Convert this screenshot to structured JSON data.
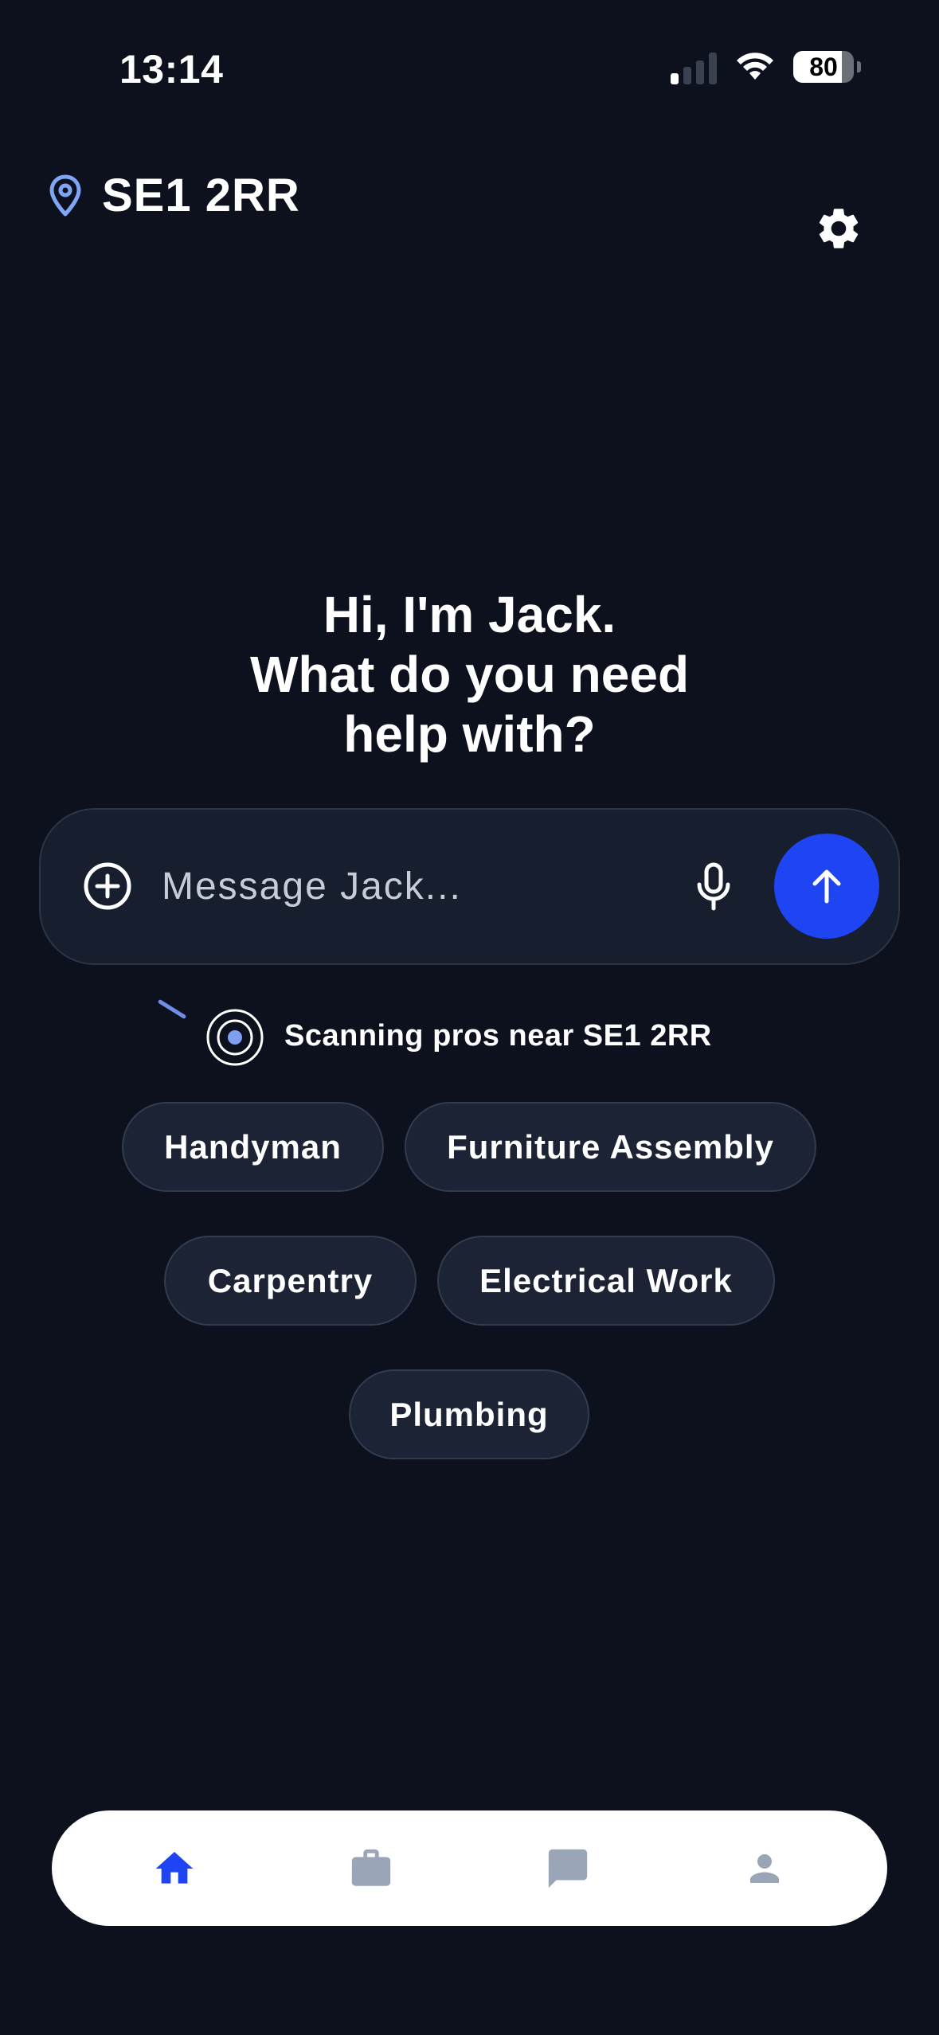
{
  "status_bar": {
    "time": "13:14",
    "battery_percent": "80",
    "signal_bars_active": 1,
    "signal_bars_total": 4
  },
  "header": {
    "location_icon": "map-pin-icon",
    "location": "SE1 2RR",
    "settings_icon": "gear-icon"
  },
  "greeting": {
    "line1": "Hi, I'm Jack.",
    "line2": "What do you need",
    "line3": "help with?"
  },
  "composer": {
    "placeholder": "Message Jack...",
    "value": "",
    "add_icon": "plus-circle-icon",
    "mic_icon": "microphone-icon",
    "send_icon": "arrow-up-icon"
  },
  "scanning": {
    "text": "Scanning pros near SE1 2RR",
    "icon": "radar-icon"
  },
  "chips": [
    {
      "label": "Handyman"
    },
    {
      "label": "Furniture Assembly"
    },
    {
      "label": "Carpentry"
    },
    {
      "label": "Electrical Work"
    },
    {
      "label": "Plumbing"
    }
  ],
  "bottom_nav": {
    "items": [
      {
        "icon": "home-icon",
        "active": true
      },
      {
        "icon": "briefcase-icon",
        "active": false
      },
      {
        "icon": "chat-icon",
        "active": false
      },
      {
        "icon": "profile-icon",
        "active": false
      }
    ]
  },
  "colors": {
    "background": "#0c111d",
    "surface": "#171e2e",
    "chip_background": "#1b2334",
    "accent": "#1f44f2",
    "location_icon": "#7fa6f5",
    "nav_inactive": "#9aa6b8"
  }
}
